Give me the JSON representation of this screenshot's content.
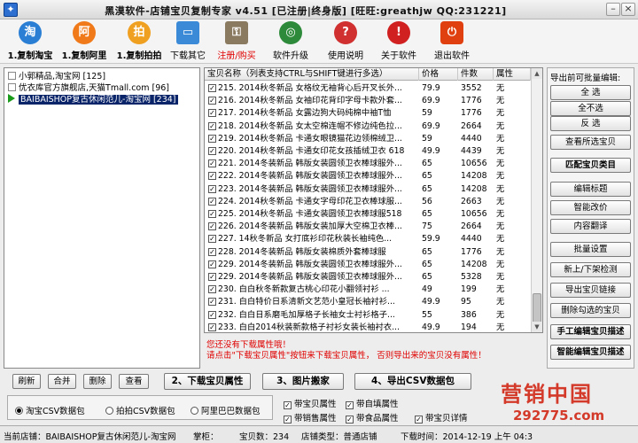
{
  "window": {
    "title": "黑漠软件-店铺宝贝复制专家  v4.51 [已注册|终身版] [旺旺:greathjw QQ:231221]"
  },
  "toolbar": {
    "items": [
      {
        "label": "1.复制淘宝",
        "icon": "taobao-icon",
        "color": "#2a7fd4"
      },
      {
        "label": "1.复制阿里",
        "icon": "alibaba-icon",
        "color": "#f07a1a"
      },
      {
        "label": "1.复制拍拍",
        "icon": "paipai-icon",
        "color": "#f0a020"
      },
      {
        "label": "下载其它",
        "icon": "computer-icon",
        "color": "#3a8ad8"
      },
      {
        "label": "注册/购买",
        "icon": "keys-icon",
        "color": "#8a7a60"
      },
      {
        "label": "软件升级",
        "icon": "globe-icon",
        "color": "#2d8a3a"
      },
      {
        "label": "使用说明",
        "icon": "help-icon",
        "color": "#d03030"
      },
      {
        "label": "关于软件",
        "icon": "pin-icon",
        "color": "#d02020"
      },
      {
        "label": "退出软件",
        "icon": "power-icon",
        "color": "#e04010"
      }
    ]
  },
  "shops": [
    {
      "label": "小郭精品,淘宝网 [125]",
      "icon": "doc-icon",
      "selected": false
    },
    {
      "label": "优衣库官方旗舰店,天猫Tmall.com [96]",
      "icon": "doc-icon",
      "selected": false
    },
    {
      "label": "BAIBAISHOP复古休闲范儿-淘宝网 [234]",
      "icon": "play-icon",
      "selected": true
    }
  ],
  "table": {
    "columns": [
      "宝贝名称（列表支持CTRL与SHIFT键进行多选）",
      "价格",
      "件数",
      "属性"
    ],
    "rows": [
      {
        "name": "215.   2014秋冬新品 女格纹无袖背心后开叉长外...",
        "price": "79.9",
        "qty": "3552",
        "attr": "无"
      },
      {
        "name": "216.   2014秋冬新品 女袖印花背印字母卡款外套...",
        "price": "69.9",
        "qty": "1776",
        "attr": "无"
      },
      {
        "name": "217.   2014秋冬新品 女露边狗大码纯棉中袖T恤",
        "price": "59",
        "qty": "1776",
        "attr": "无"
      },
      {
        "name": "218.   2014秋冬新品 女太空棉连帽不修边纯色拉...",
        "price": "69.9",
        "qty": "2664",
        "attr": "无"
      },
      {
        "name": "219.   2014秋冬新品 卡通女眼镜猫花边领棉绒卫...",
        "price": "59",
        "qty": "4440",
        "attr": "无"
      },
      {
        "name": "220.   2014秋冬新品 卡通女印花女孩插绒卫衣 618",
        "price": "49.9",
        "qty": "4439",
        "attr": "无"
      },
      {
        "name": "221.   2014冬装新品 韩版女装圆领卫衣棒球服外...",
        "price": "65",
        "qty": "10656",
        "attr": "无"
      },
      {
        "name": "222.   2014冬装新品 韩版女装圆领卫衣棒球服外...",
        "price": "65",
        "qty": "14208",
        "attr": "无"
      },
      {
        "name": "223.   2014冬装新品 韩版女装圆领卫衣棒球服外...",
        "price": "65",
        "qty": "14208",
        "attr": "无"
      },
      {
        "name": "224.   2014秋冬新品 卡通女字母印花卫衣棒球服...",
        "price": "56",
        "qty": "2663",
        "attr": "无"
      },
      {
        "name": "225.   2014秋冬新品 卡通女装圆领卫衣棒球服518",
        "price": "65",
        "qty": "10656",
        "attr": "无"
      },
      {
        "name": "226.   2014冬装新品 韩版女装加厚大空棉卫衣棒...",
        "price": "75",
        "qty": "2664",
        "attr": "无"
      },
      {
        "name": "227.   14秋冬新品 女打底衫印花秋装长袖纯色...",
        "price": "59.9",
        "qty": "4440",
        "attr": "无"
      },
      {
        "name": "228.   2014冬装新品 韩版女装棉质外套棒球服",
        "price": "65",
        "qty": "1776",
        "attr": "无"
      },
      {
        "name": "229.   2014冬装新品 韩版女装圆领卫衣棒球服外...",
        "price": "65",
        "qty": "14208",
        "attr": "无"
      },
      {
        "name": "229.   2014冬装新品 韩版女装圆领卫衣棒球服外...",
        "price": "65",
        "qty": "5328",
        "attr": "无"
      },
      {
        "name": "230.   白白秋冬新款复古桃心印花小翻领衬衫 ...",
        "price": "49",
        "qty": "199",
        "attr": "无"
      },
      {
        "name": "231.   白白特价日系清新文艺范小皇冠长袖衬衫...",
        "price": "49.9",
        "qty": "95",
        "attr": "无"
      },
      {
        "name": "232.   白白日系磨毛加厚格子长袖女士衬衫格子...",
        "price": "55",
        "qty": "386",
        "attr": "无"
      },
      {
        "name": "233.   白白2014秋装新款格子衬衫女装长袖衬衣...",
        "price": "49.9",
        "qty": "194",
        "attr": "无"
      },
      {
        "name": "234.   白白2014秋季新款长袖衬衫女白色刺绣小...",
        "price": "49.9",
        "qty": "293",
        "attr": "无"
      }
    ]
  },
  "side": {
    "label": "导出前可批量编辑:",
    "buttons": [
      "全  选",
      "全不选",
      "反  选",
      "查看所选宝贝",
      "匹配宝贝类目",
      "编辑标题",
      "智能改价",
      "内容翻译",
      "批量设置",
      "新上/下架检测",
      "导出宝贝链接",
      "删除勾选的宝贝",
      "手工编辑宝贝描述",
      "智能编辑宝贝描述"
    ]
  },
  "warning": {
    "line1": "您还没有下载属性哦！",
    "line2": "请点击\"下载宝贝属性\"按钮来下载宝贝属性，  否则导出来的宝贝没有属性！"
  },
  "bottom_buttons": {
    "refresh": "刷新",
    "merge": "合并",
    "delete": "删除",
    "view": "查看",
    "download_attr": "2、下载宝贝属性",
    "image_move": "3、图片搬家",
    "export_csv": "4、导出CSV数据包"
  },
  "formats": {
    "selected": "taobao",
    "options": [
      {
        "key": "taobao",
        "label": "淘宝CSV数据包"
      },
      {
        "key": "paipai",
        "label": "拍拍CSV数据包"
      },
      {
        "key": "alibaba",
        "label": "阿里巴巴数据包"
      }
    ]
  },
  "attr_checks": [
    {
      "label": "带宝贝属性",
      "checked": true
    },
    {
      "label": "带自填属性",
      "checked": true
    },
    {
      "label": "带销售属性",
      "checked": true
    },
    {
      "label": "带食品属性",
      "checked": true
    },
    {
      "label": "带宝贝详情",
      "checked": true
    }
  ],
  "status": {
    "current_shop": "当前店铺：BAIBAISHOP复古休闲范儿-淘宝网",
    "shop_number": "掌柜：",
    "count": "宝贝数：234",
    "shop_type": "店铺类型：普通店铺",
    "download_time": "下载时间：2014-12-19 上午 04:3"
  },
  "watermark": {
    "brand": "营销中国",
    "url": "292775.com"
  }
}
